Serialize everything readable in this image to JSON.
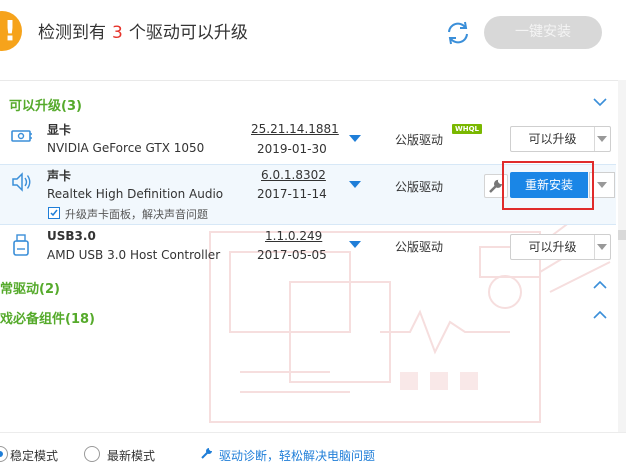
{
  "header": {
    "title_prefix": "检测到有",
    "update_count": "3",
    "title_suffix": "个驱动可以升级",
    "warn_symbol": "!",
    "install_all_label": "一键安装"
  },
  "sections": {
    "upgradable": {
      "label": "可以升级(3)"
    },
    "normal": {
      "label": "常驱动(2)"
    },
    "components": {
      "label": "戏必备组件(18)"
    }
  },
  "devices": [
    {
      "name": "显卡",
      "model": "NVIDIA GeForce GTX 1050",
      "version": "25.21.14.1881",
      "date": "2019-01-30",
      "driver_type": "公版驱动",
      "badge": "WHQL",
      "action_label": "可以升级",
      "icon": "gpu-card-icon"
    },
    {
      "name": "声卡",
      "model": "Realtek High Definition Audio",
      "version": "6.0.1.8302",
      "date": "2017-11-14",
      "driver_type": "公版驱动",
      "sub_note": "升级声卡面板，解决声音问题",
      "action_label": "重新安装",
      "icon": "speaker-icon"
    },
    {
      "name": "USB3.0",
      "model": "AMD USB 3.0 Host Controller",
      "version": "1.1.0.249",
      "date": "2017-05-05",
      "driver_type": "公版驱动",
      "action_label": "可以升级",
      "icon": "usb-drive-icon"
    }
  ],
  "footer": {
    "stable_mode": "稳定模式",
    "latest_mode": "最新模式",
    "diagnose_link": "驱动诊断，轻松解决电脑问题"
  },
  "colors": {
    "accent_blue": "#1a86e6",
    "section_green": "#55aa2b",
    "count_red": "#e6332a",
    "warn_orange": "#f6a31b",
    "highlight_red": "#e02b2b"
  }
}
